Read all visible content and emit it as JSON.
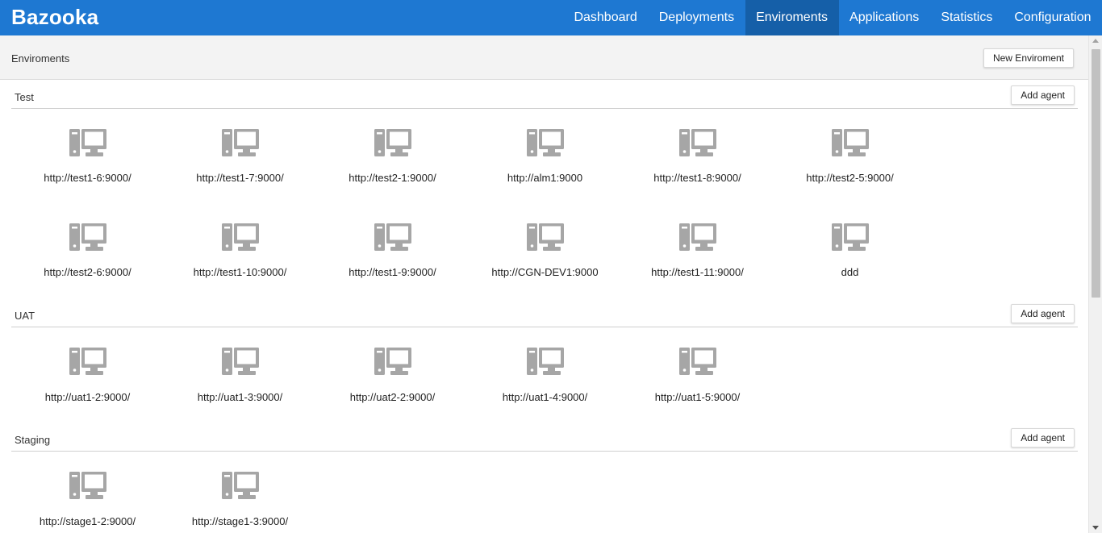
{
  "app": {
    "brand": "Bazooka"
  },
  "nav": [
    {
      "label": "Dashboard",
      "active": false
    },
    {
      "label": "Deployments",
      "active": false
    },
    {
      "label": "Enviroments",
      "active": true
    },
    {
      "label": "Applications",
      "active": false
    },
    {
      "label": "Statistics",
      "active": false
    },
    {
      "label": "Configuration",
      "active": false
    }
  ],
  "page": {
    "title": "Enviroments",
    "new_button": "New Enviroment"
  },
  "environments": [
    {
      "name": "Test",
      "add_button": "Add agent",
      "agents": [
        "http://test1-6:9000/",
        "http://test1-7:9000/",
        "http://test2-1:9000/",
        "http://alm1:9000",
        "http://test1-8:9000/",
        "http://test2-5:9000/",
        "http://test2-6:9000/",
        "http://test1-10:9000/",
        "http://test1-9:9000/",
        "http://CGN-DEV1:9000",
        "http://test1-11:9000/",
        "ddd"
      ]
    },
    {
      "name": "UAT",
      "add_button": "Add agent",
      "agents": [
        "http://uat1-2:9000/",
        "http://uat1-3:9000/",
        "http://uat2-2:9000/",
        "http://uat1-4:9000/",
        "http://uat1-5:9000/"
      ]
    },
    {
      "name": "Staging",
      "add_button": "Add agent",
      "agents": [
        "http://stage1-2:9000/",
        "http://stage1-3:9000/"
      ]
    }
  ],
  "colors": {
    "navbar": "#1e78d2",
    "nav_active": "#155fa8",
    "agent_icon": "#a6a6a6"
  },
  "icons": {
    "agent": "computer-icon"
  }
}
